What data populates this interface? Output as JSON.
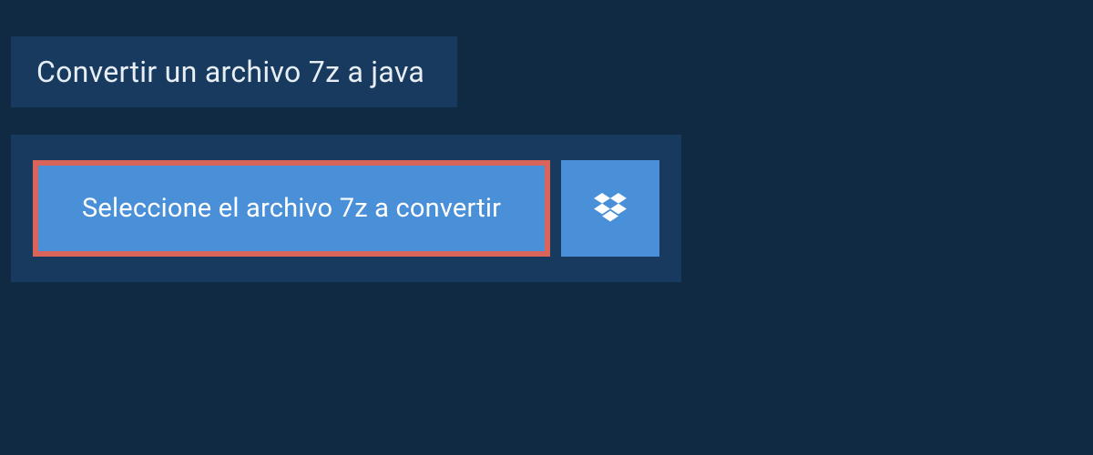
{
  "header": {
    "title": "Convertir un archivo 7z a java"
  },
  "upload": {
    "select_button_label": "Seleccione el archivo 7z a convertir"
  },
  "colors": {
    "background": "#102a43",
    "panel": "#173a5e",
    "button": "#4a90d9",
    "highlight_border": "#d96459",
    "text_light": "#e8eef5",
    "text_white": "#ffffff"
  }
}
